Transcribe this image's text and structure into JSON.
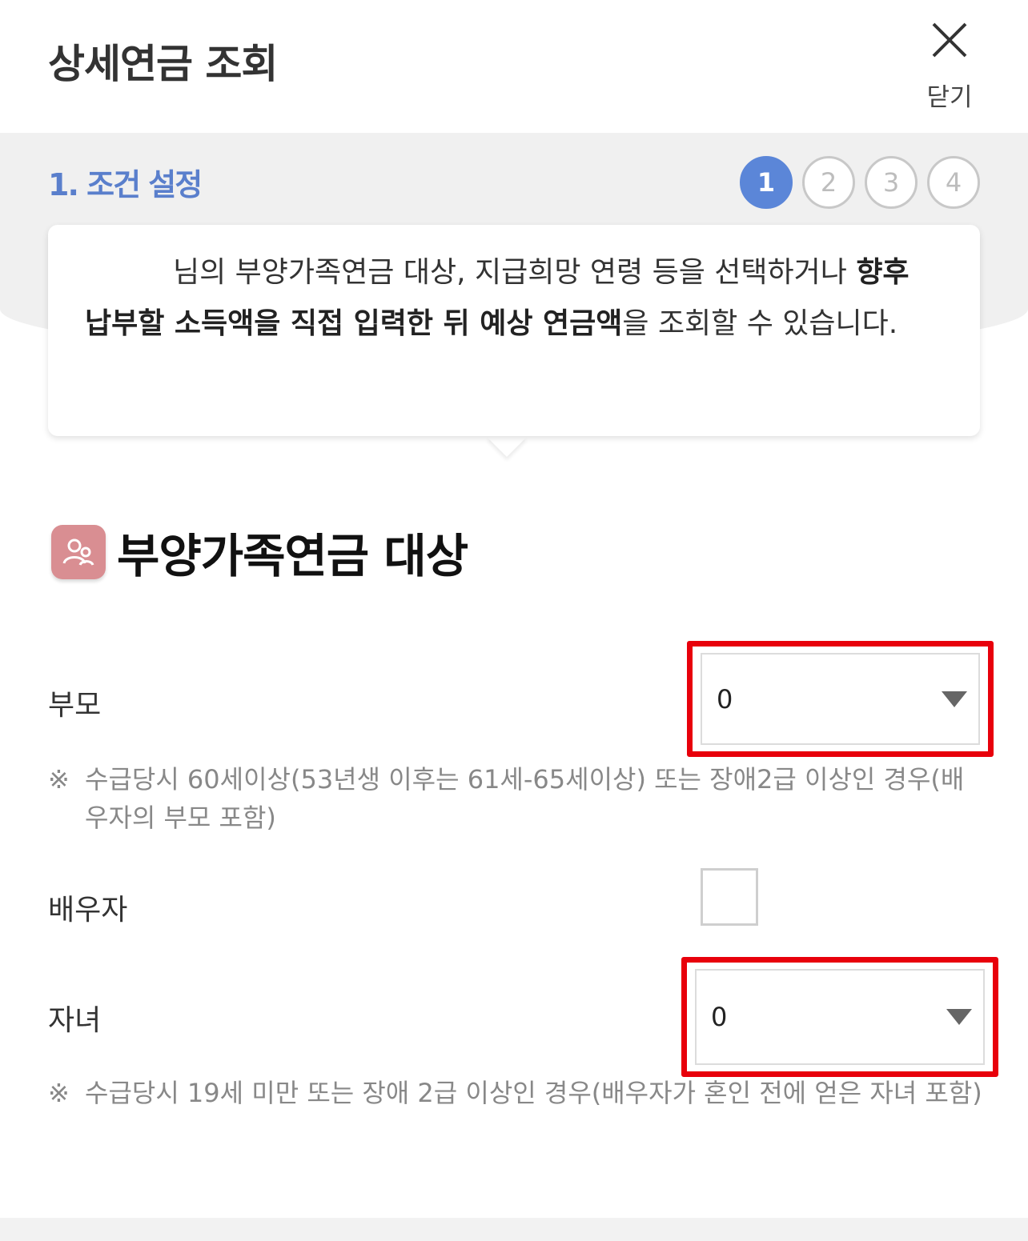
{
  "header": {
    "title": "상세연금 조회",
    "close_label": "닫기",
    "close_icon": "close-icon"
  },
  "step": {
    "title": "1. 조건 설정",
    "steps": [
      "1",
      "2",
      "3",
      "4"
    ],
    "active": 1
  },
  "tooltip": {
    "prefix": "님의 부양가족연금 대상, 지급희망 연령 등을 선택하거나 ",
    "bold": "향후 납부할 소득액을 직접 입력한 뒤 예상 연금액",
    "suffix": "을 조회할 수 있습니다."
  },
  "section": {
    "icon": "family-icon",
    "title": "부양가족연금 대상"
  },
  "parents": {
    "label": "부모",
    "value": "0",
    "note_mark": "※",
    "note": "수급당시 60세이상(53년생 이후는 61세-65세이상) 또는 장애2급 이상인 경우(배우자의 부모 포함)"
  },
  "spouse": {
    "label": "배우자"
  },
  "children": {
    "label": "자녀",
    "value": "0",
    "note_mark": "※",
    "note": "수급당시 19세 미만 또는 장애 2급 이상인 경우(배우자가 혼인 전에 얻은 자녀 포함)"
  },
  "colors": {
    "accent": "#5b86d8",
    "highlight": "#e8000b",
    "icon_bg": "#d98e92"
  }
}
